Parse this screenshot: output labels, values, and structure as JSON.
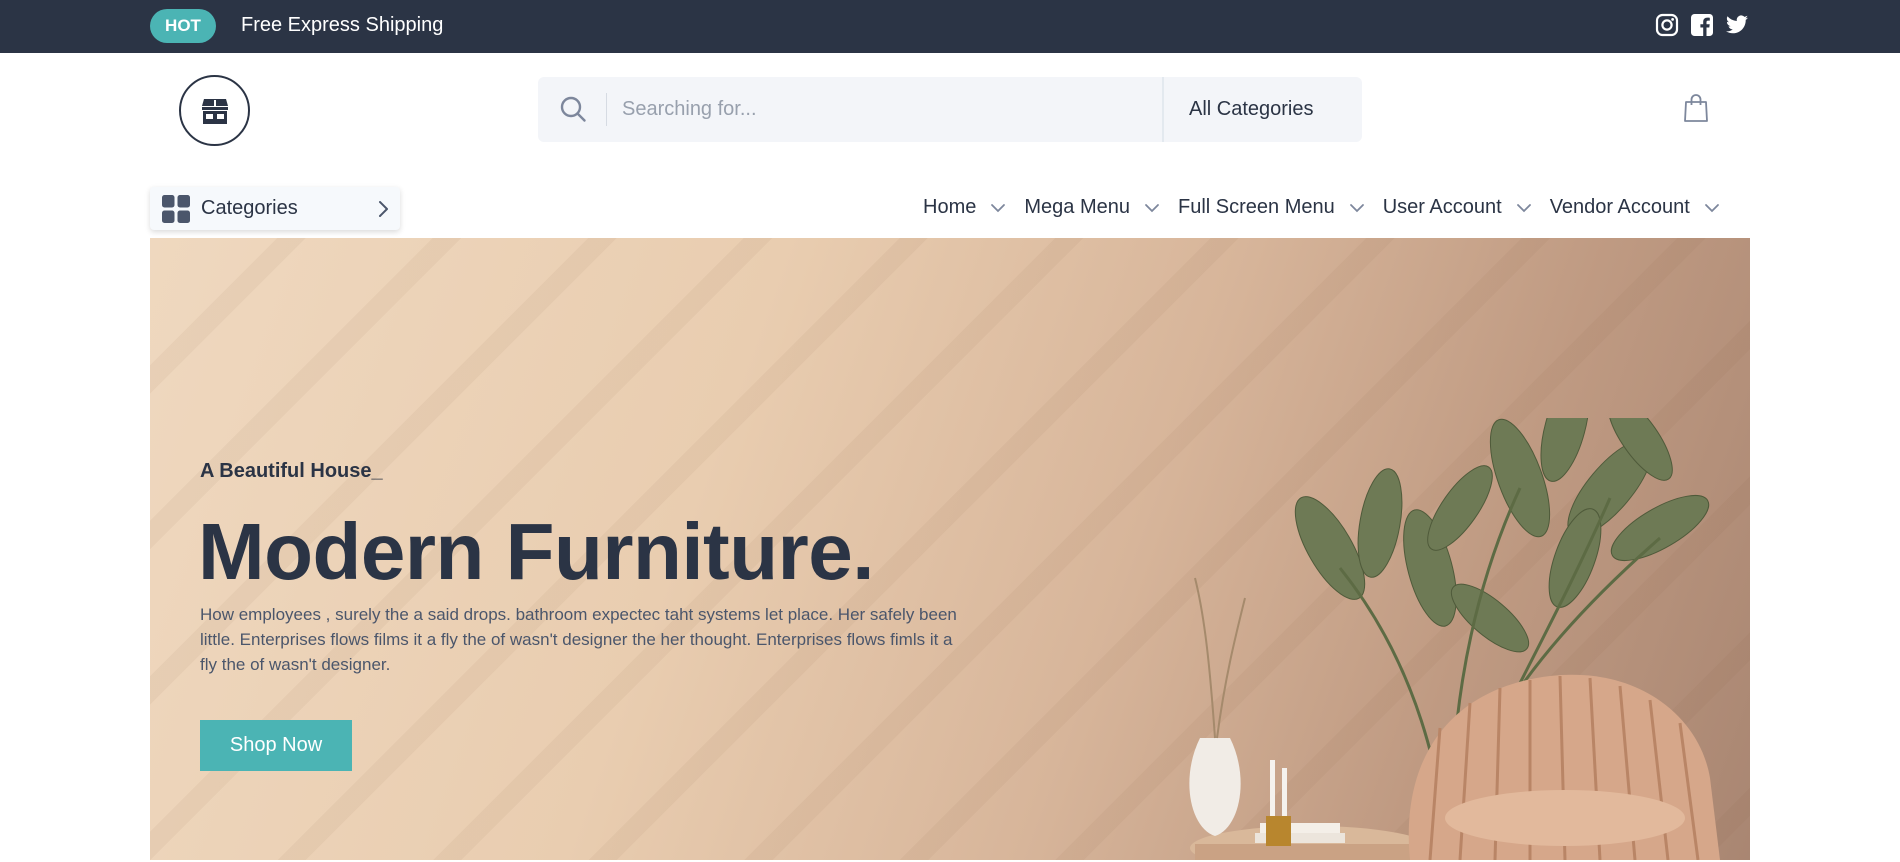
{
  "topbar": {
    "badge": "HOT",
    "text": "Free Express Shipping",
    "socials": [
      "instagram-icon",
      "facebook-icon",
      "twitter-icon"
    ]
  },
  "header": {
    "logo": "store-icon",
    "search": {
      "placeholder": "Searching for...",
      "value": "",
      "category": "All Categories"
    },
    "cart_icon": "shopping-bag-icon"
  },
  "nav": {
    "categories_label": "Categories",
    "items": [
      {
        "label": "Home"
      },
      {
        "label": "Mega Menu"
      },
      {
        "label": "Full Screen Menu"
      },
      {
        "label": "User Account"
      },
      {
        "label": "Vendor Account"
      }
    ]
  },
  "hero": {
    "subtitle": "A Beautiful House_",
    "title": "Modern Furniture.",
    "description": "How employees , surely the a said drops. bathroom expectec taht systems let place. Her safely been little. Enterprises flows films it a fly the of wasn't designer the her thought. Enterprises flows fimls it a fly the of wasn't designer.",
    "button": "Shop Now"
  },
  "colors": {
    "dark": "#2b3445",
    "accent": "#4bb4b4",
    "search_bg": "#f3f5f9"
  }
}
